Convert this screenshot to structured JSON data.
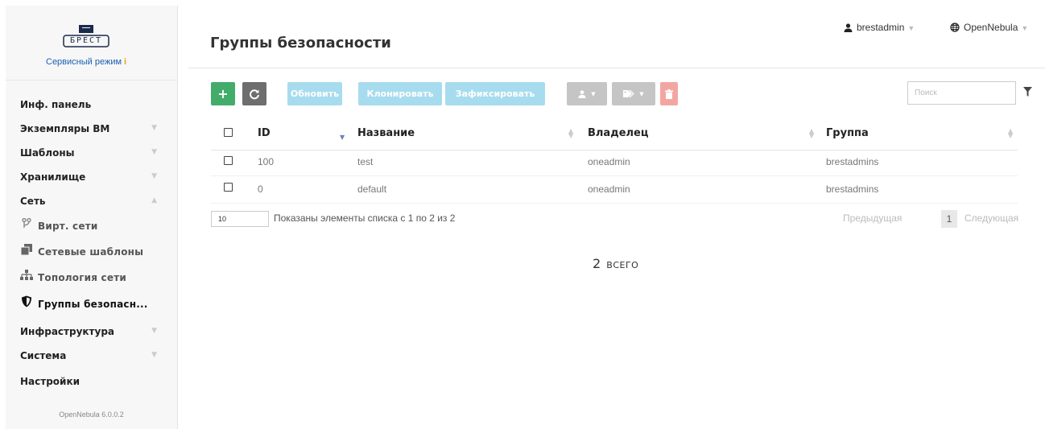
{
  "brand": {
    "logo_text": "БРЕСТ",
    "mode_label": "Сервисный режим",
    "info_mark": "i",
    "version": "OpenNebula 6.0.0.2"
  },
  "sidebar": {
    "items": [
      {
        "label": "Инф. панель"
      },
      {
        "label": "Экземпляры ВМ"
      },
      {
        "label": "Шаблоны"
      },
      {
        "label": "Хранилище"
      },
      {
        "label": "Сеть"
      },
      {
        "label": "Инфраструктура"
      },
      {
        "label": "Система"
      },
      {
        "label": "Настройки"
      }
    ],
    "network_subitems": [
      {
        "label": "Вирт. сети",
        "icon": "branch-icon"
      },
      {
        "label": "Сетевые шаблоны",
        "icon": "clone-icon"
      },
      {
        "label": "Топология сети",
        "icon": "sitemap-icon"
      },
      {
        "label": "Группы безопасн...",
        "icon": "shield-icon"
      }
    ]
  },
  "header": {
    "title": "Группы безопасности",
    "user": "brestadmin",
    "zone": "OpenNebula"
  },
  "toolbar": {
    "add": "+",
    "refresh": "⟳",
    "update": "Обновить",
    "clone": "Клонировать",
    "commit": "Зафиксировать",
    "search_placeholder": "Поиск"
  },
  "table": {
    "columns": [
      "ID",
      "Название",
      "Владелец",
      "Группа"
    ],
    "rows": [
      {
        "id": "100",
        "name": "test",
        "owner": "oneadmin",
        "group": "brestadmins"
      },
      {
        "id": "0",
        "name": "default",
        "owner": "oneadmin",
        "group": "brestadmins"
      }
    ]
  },
  "pagination": {
    "page_length": "10",
    "info": "Показаны элементы списка с 1 по 2 из 2",
    "prev": "Предыдущая",
    "current": "1",
    "next": "Следующая"
  },
  "summary": {
    "count": "2",
    "label": "ВСЕГО"
  },
  "colors": {
    "add_button": "#43ac6a",
    "refresh_button": "#6e6e6e",
    "text_buttons": "#a7dcef",
    "delete_button": "#f3a6a1",
    "accent_link": "#1a5fb4"
  }
}
